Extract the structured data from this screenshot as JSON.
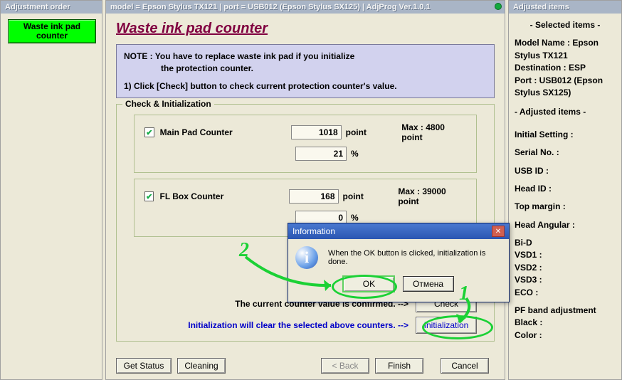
{
  "left_panel": {
    "caption": "Adjustment order",
    "button_label": "Waste ink pad counter"
  },
  "mid_panel": {
    "caption": "model = Epson Stylus TX121 | port = USB012 (Epson Stylus SX125) | AdjProg Ver.1.0.1",
    "title": "Waste ink pad counter",
    "note_line1": "NOTE : You have to replace waste ink pad if you initialize",
    "note_line2": "the protection counter.",
    "note_line3": "1) Click [Check] button to check current protection counter's value.",
    "group_title": "Check & Initialization",
    "counters": [
      {
        "name": "Main Pad Counter",
        "checked": true,
        "value": "1018",
        "unit": "point",
        "max": "Max : 4800 point",
        "pct": "21",
        "pct_unit": "%"
      },
      {
        "name": "FL Box Counter",
        "checked": true,
        "value": "168",
        "unit": "point",
        "max": "Max : 39000 point",
        "pct": "0",
        "pct_unit": "%"
      }
    ],
    "check_line": "The current counter value is confirmed. -->",
    "check_btn": "Check",
    "init_line": "Initialization will clear the selected above counters. -->",
    "init_btn": "Initialization",
    "bottom": {
      "get_status": "Get Status",
      "cleaning": "Cleaning",
      "back": "< Back",
      "finish": "Finish",
      "cancel": "Cancel"
    }
  },
  "dialog": {
    "title": "Information",
    "message": "When the OK button is clicked, initialization is done.",
    "ok": "OK",
    "cancel": "Отмена"
  },
  "right_panel": {
    "caption": "Adjusted items",
    "selected_header": "- Selected items -",
    "model_name": "Model Name : Epson Stylus TX121",
    "destination": "Destination : ESP",
    "port": "Port : USB012 (Epson Stylus SX125)",
    "adjusted_header": "- Adjusted items -",
    "items": [
      "Initial Setting :",
      "Serial No. :",
      "USB ID :",
      "Head ID :",
      "Top margin :",
      "Head Angular :",
      "Bi-D",
      " VSD1 :",
      " VSD2 :",
      " VSD3 :",
      " ECO  :",
      "PF band adjustment",
      "Black :",
      "Color :"
    ]
  },
  "annotations": {
    "num1": "1",
    "num2": "2"
  }
}
